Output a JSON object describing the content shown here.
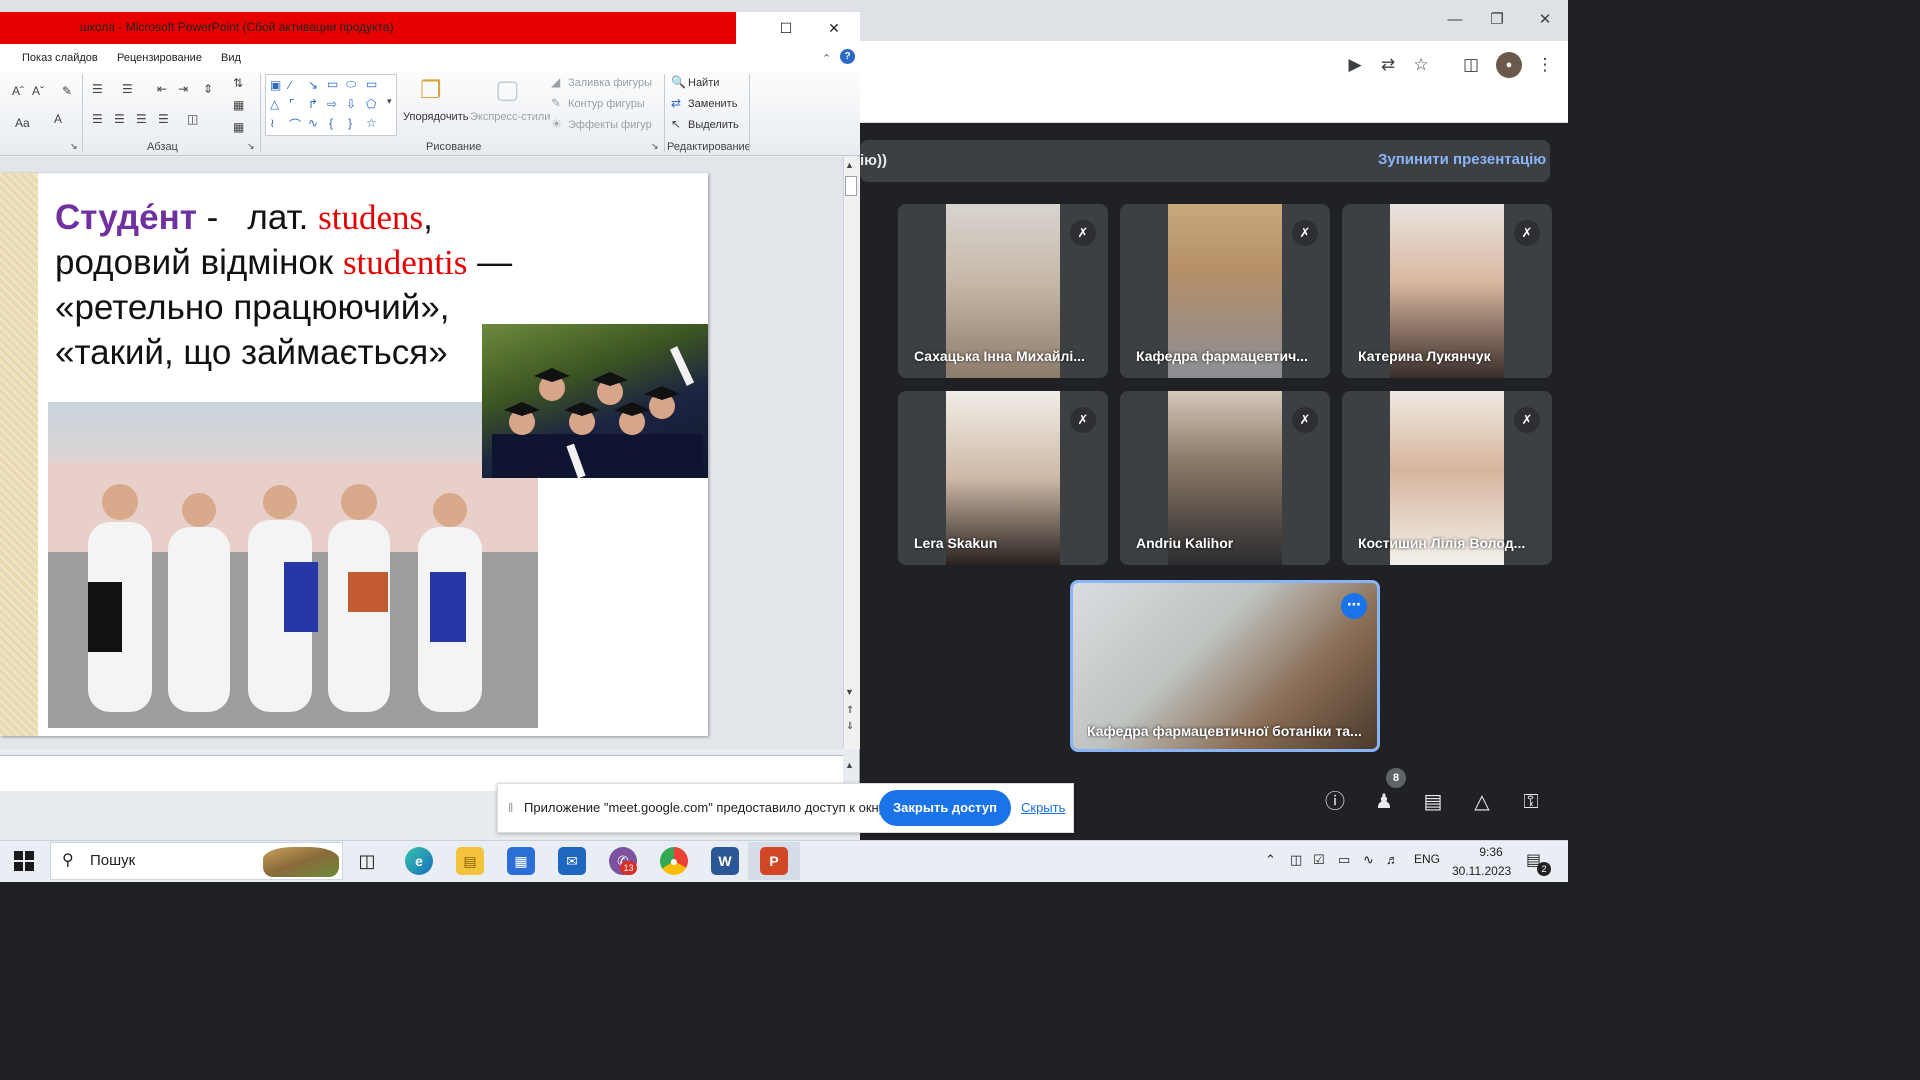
{
  "ppt": {
    "title": "школа - Microsoft PowerPoint (Сбой активации продукта)",
    "tabs": [
      "Показ слайдов",
      "Рецензирование",
      "Вид"
    ],
    "groups": {
      "paragraph": "Абзац",
      "drawing": "Рисование",
      "editing": "Редактирование"
    },
    "buttons": {
      "arrange": "Упорядочить",
      "quick_styles": "Экспресс-стили",
      "shape_fill": "Заливка фигуры",
      "shape_outline": "Контур фигуры",
      "shape_effects": "Эффекты фигур",
      "find": "Найти",
      "replace": "Заменить",
      "select": "Выделить"
    },
    "slide": {
      "word": "Студе́нт",
      "dash": " -   лат. ",
      "latin": "studens",
      "comma": ",",
      "line2_a": "родовий відмінок ",
      "line2_latin": "studentis",
      "line2_b": " —",
      "line3": "«ретельно працюючий»,",
      "line4": "«такий, що займається»"
    }
  },
  "meet": {
    "presentation_title": "ію))",
    "stop_presenting": "Зупинити презентацію",
    "participants": [
      {
        "name": "Сахацька Інна Михайлі..."
      },
      {
        "name": "Кафедра фармацевтич..."
      },
      {
        "name": "Катерина Лукянчук"
      },
      {
        "name": "Lera Skakun"
      },
      {
        "name": "Andriu Kalihor"
      },
      {
        "name": "Костишин Лілія Волод..."
      }
    ],
    "self_name": "Кафедра фармацевтичної ботаніки та...",
    "people_count": "8"
  },
  "share_bar": {
    "message": "Приложение \"meet.google.com\" предоставило доступ к окну.",
    "stop": "Закрыть доступ",
    "hide": "Скрыть"
  },
  "taskbar": {
    "search": "Пошук",
    "viber_badge": "13",
    "lang": "ENG",
    "time": "9:36",
    "date": "30.11.2023",
    "notifications": "2"
  },
  "colors": {
    "ppt_title_bar": "#e60000",
    "meet_bg": "#202124",
    "meet_accent": "#8ab4f8",
    "google_blue": "#1a73e8",
    "slide_purple": "#7030a0",
    "slide_red": "#e60000"
  }
}
